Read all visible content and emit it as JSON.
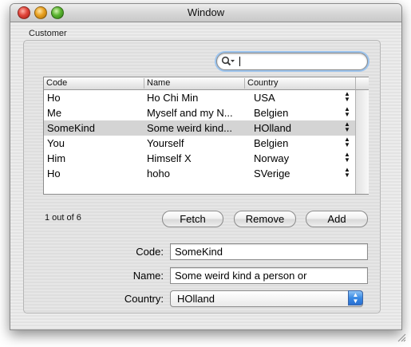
{
  "window": {
    "title": "Window"
  },
  "group": {
    "label": "Customer"
  },
  "search": {
    "value": "",
    "placeholder": ""
  },
  "table": {
    "columns": [
      "Code",
      "Name",
      "Country"
    ],
    "rows": [
      {
        "code": "Ho",
        "name": "Ho Chi Min",
        "country": "USA",
        "selected": false
      },
      {
        "code": "Me",
        "name": "Myself and my N...",
        "country": "Belgien",
        "selected": false
      },
      {
        "code": "SomeKind",
        "name": "Some weird kind...",
        "country": "HOlland",
        "selected": true
      },
      {
        "code": "You",
        "name": "Yourself",
        "country": "Belgien",
        "selected": false
      },
      {
        "code": "Him",
        "name": "Himself X",
        "country": "Norway",
        "selected": false
      },
      {
        "code": "Ho",
        "name": "hoho",
        "country": "SVerige",
        "selected": false
      }
    ]
  },
  "status": {
    "count_text": "1 out of 6"
  },
  "buttons": {
    "fetch": "Fetch",
    "remove": "Remove",
    "add": "Add"
  },
  "form": {
    "code_label": "Code:",
    "code_value": "SomeKind",
    "name_label": "Name:",
    "name_value": "Some weird kind a person or",
    "country_label": "Country:",
    "country_value": "HOlland"
  },
  "colors": {
    "selection": "#d4d4d4",
    "focus_ring": "#9cc4ee",
    "popup_accent": "#3a8ae4"
  },
  "icons": [
    "close-icon",
    "minimize-icon",
    "zoom-icon",
    "search-icon",
    "stepper-icon",
    "popup-arrows-icon",
    "resize-grip-icon"
  ]
}
